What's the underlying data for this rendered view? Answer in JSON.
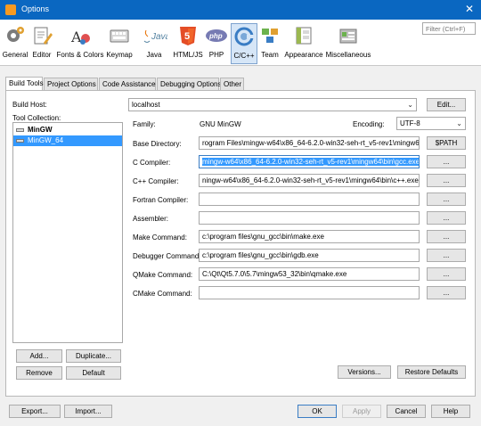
{
  "window": {
    "title": "Options",
    "close_glyph": "✕"
  },
  "toolbar": {
    "categories": [
      {
        "label": "General",
        "icon": "gear-icon"
      },
      {
        "label": "Editor",
        "icon": "editor-icon"
      },
      {
        "label": "Fonts & Colors",
        "icon": "fonts-colors-icon"
      },
      {
        "label": "Keymap",
        "icon": "keyboard-icon"
      },
      {
        "label": "Java",
        "icon": "java-icon",
        "text": "Java"
      },
      {
        "label": "HTML/JS",
        "icon": "html5-icon",
        "text": "5"
      },
      {
        "label": "PHP",
        "icon": "php-icon",
        "text": "php"
      },
      {
        "label": "C/C++",
        "icon": "cpp-icon"
      },
      {
        "label": "Team",
        "icon": "team-icon"
      },
      {
        "label": "Appearance",
        "icon": "appearance-icon"
      },
      {
        "label": "Miscellaneous",
        "icon": "miscellaneous-icon"
      }
    ],
    "selected": "C/C++"
  },
  "filter": {
    "placeholder": "Filter (Ctrl+F)"
  },
  "tabs": [
    "Build Tools",
    "Project Options",
    "Code Assistance",
    "Debugging Options",
    "Other"
  ],
  "build_host": {
    "label": "Build Host:",
    "value": "localhost",
    "edit_button": "Edit..."
  },
  "tool_collection": {
    "label": "Tool Collection:",
    "items": [
      {
        "name": "MinGW",
        "bold": true,
        "selected": false
      },
      {
        "name": "MinGW_64",
        "bold": false,
        "selected": true
      }
    ],
    "add_button": "Add...",
    "duplicate_button": "Duplicate...",
    "remove_button": "Remove",
    "default_button": "Default"
  },
  "family": {
    "label": "Family:",
    "value": "GNU MinGW"
  },
  "encoding": {
    "label": "Encoding:",
    "value": "UTF-8"
  },
  "fields": [
    {
      "label": "Base Directory:",
      "value": "rogram Files\\mingw-w64\\x86_64-6.2.0-win32-seh-rt_v5-rev1\\mingw64",
      "button": "$PATH",
      "selected": false
    },
    {
      "label": "C Compiler:",
      "value": "mingw-w64\\x86_64-6.2.0-win32-seh-rt_v5-rev1\\mingw64\\bin\\gcc.exe",
      "button": "...",
      "selected": true
    },
    {
      "label": "C++ Compiler:",
      "value": "ningw-w64\\x86_64-6.2.0-win32-seh-rt_v5-rev1\\mingw64\\bin\\c++.exe",
      "button": "...",
      "selected": false
    },
    {
      "label": "Fortran Compiler:",
      "value": "",
      "button": "...",
      "selected": false
    },
    {
      "label": "Assembler:",
      "value": "",
      "button": "...",
      "selected": false
    },
    {
      "label": "Make Command:",
      "value": "c:\\program files\\gnu_gcc\\bin\\make.exe",
      "button": "...",
      "selected": false
    },
    {
      "label": "Debugger Command:",
      "value": "c:\\program files\\gnu_gcc\\bin\\gdb.exe",
      "button": "...",
      "selected": false
    },
    {
      "label": "QMake Command:",
      "value": "C:\\Qt\\Qt5.7.0\\5.7\\mingw53_32\\bin\\qmake.exe",
      "button": "...",
      "selected": false
    },
    {
      "label": "CMake Command:",
      "value": "",
      "button": "...",
      "selected": false
    }
  ],
  "versions_button": "Versions...",
  "restore_defaults_button": "Restore Defaults",
  "footer": {
    "export_button": "Export...",
    "import_button": "Import...",
    "ok_button": "OK",
    "apply_button": "Apply",
    "cancel_button": "Cancel",
    "help_button": "Help"
  },
  "colors": {
    "titlebar": "#0a67c1",
    "selection": "#3399ff",
    "selected_category_bg": "#d6e6f7"
  }
}
